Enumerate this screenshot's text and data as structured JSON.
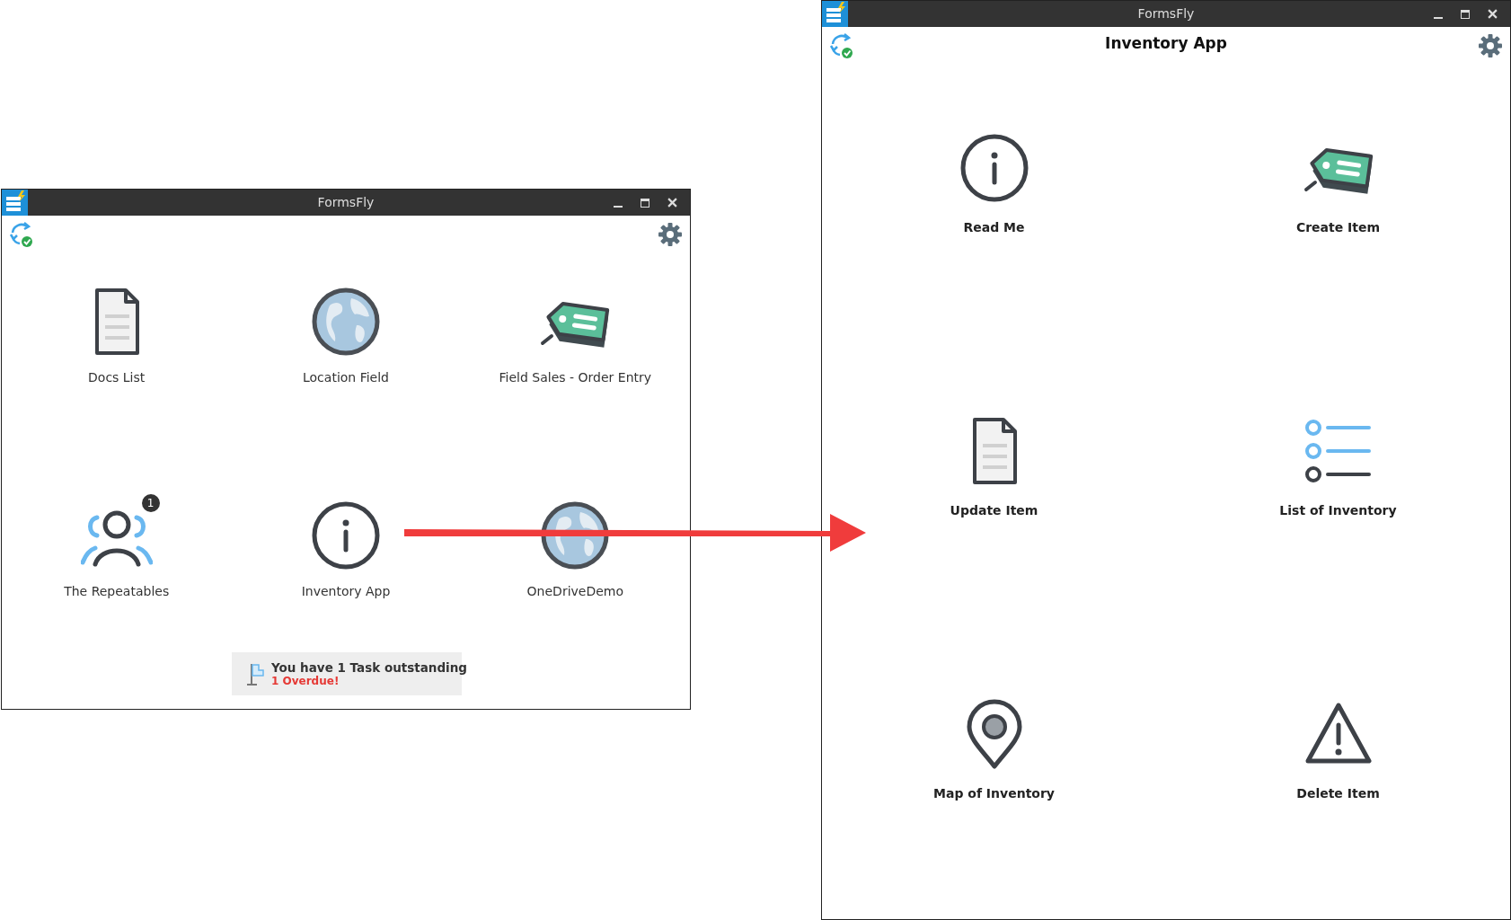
{
  "windows": [
    {
      "kind": "home",
      "title": "FormsFly",
      "tiles": [
        {
          "kind": "doc",
          "label": "Docs List"
        },
        {
          "kind": "globe",
          "label": "Location Field"
        },
        {
          "kind": "tag",
          "label": "Field Sales - Order Entry"
        },
        {
          "kind": "people",
          "label": "The Repeatables",
          "badge": "1"
        },
        {
          "kind": "info",
          "label": "Inventory App"
        },
        {
          "kind": "globe",
          "label": "OneDriveDemo"
        }
      ],
      "task_notice": {
        "message": "You have 1 Task outstanding",
        "overdue": "1 Overdue!"
      }
    },
    {
      "kind": "app",
      "title": "FormsFly",
      "heading": "Inventory App",
      "tiles": [
        {
          "kind": "info",
          "label": "Read Me"
        },
        {
          "kind": "tag",
          "label": "Create Item"
        },
        {
          "kind": "doc",
          "label": "Update Item"
        },
        {
          "kind": "list",
          "label": "List of Inventory"
        },
        {
          "kind": "pin",
          "label": "Map of Inventory"
        },
        {
          "kind": "warning",
          "label": "Delete Item"
        }
      ]
    }
  ]
}
